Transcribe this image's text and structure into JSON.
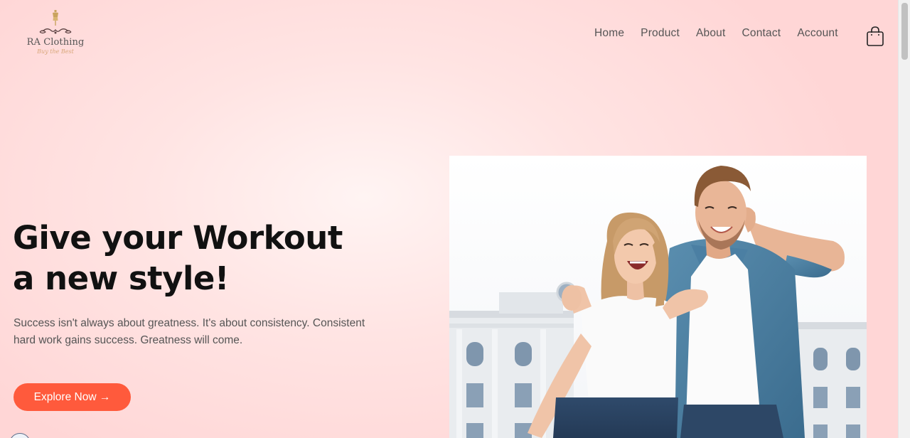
{
  "brand": {
    "name": "RA Clothing",
    "tagline": "Buy the Best"
  },
  "nav": {
    "items": [
      {
        "label": "Home"
      },
      {
        "label": "Product"
      },
      {
        "label": "About"
      },
      {
        "label": "Contact"
      },
      {
        "label": "Account"
      }
    ],
    "cart_icon": "shopping-bag-icon"
  },
  "hero": {
    "title_line1": "Give your Workout",
    "title_line2": "a new style!",
    "subtitle_line1": "Success isn't always about greatness. It's about consistency. Consistent",
    "subtitle_line2": "hard work gains success. Greatness will come.",
    "cta_label": "Explore Now →",
    "image": "couple-laughing-photo"
  },
  "colors": {
    "accent": "#ff5a3c",
    "background": "#ffdcdc",
    "text": "#111111"
  }
}
